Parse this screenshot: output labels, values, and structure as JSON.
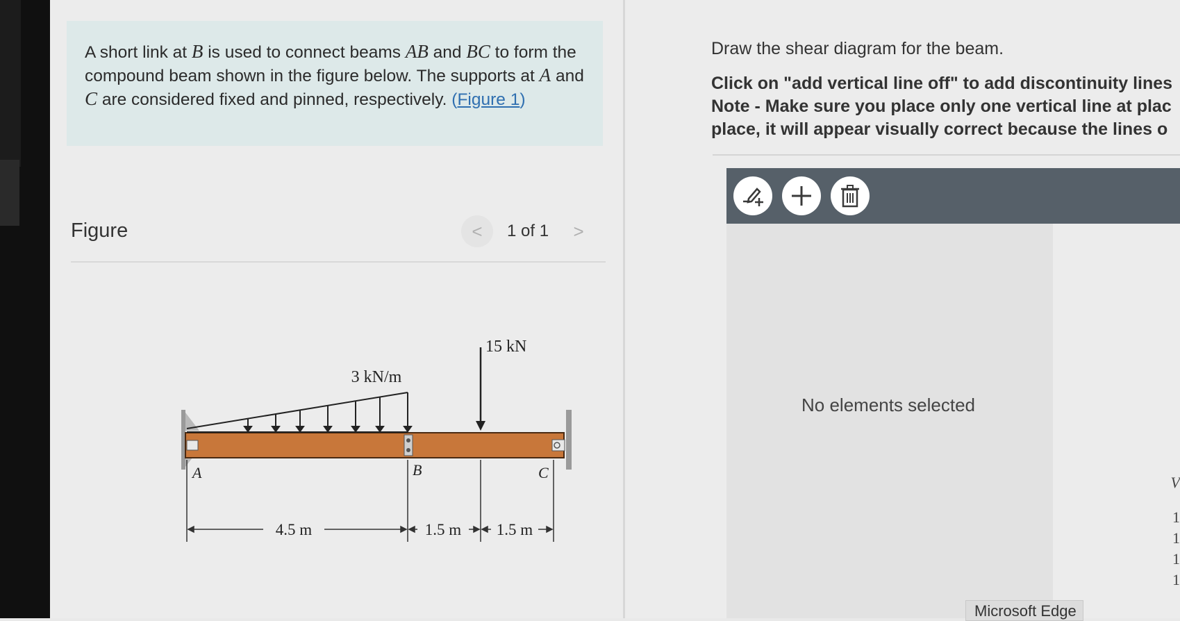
{
  "problem": {
    "p1": "A short link at ",
    "m1": "B",
    "p2": " is used to connect beams ",
    "m2": "AB",
    "p3": " and ",
    "m3": "BC",
    "p4": " to form the compound beam shown in the figure below. The supports at ",
    "m4": "A",
    "p5": " and ",
    "m5": "C",
    "p6": " are considered fixed and pinned, respectively. ",
    "link_open": "(",
    "link_text": "Figure 1",
    "link_close": ")"
  },
  "figure": {
    "title": "Figure",
    "pager_prev": "<",
    "pager_text": "1 of 1",
    "pager_next": ">"
  },
  "beam": {
    "load_point": "15 kN",
    "load_dist": "3 kN/m",
    "label_a": "A",
    "label_b": "B",
    "label_c": "C",
    "dim_ab": "4.5 m",
    "dim_b_load": "1.5 m",
    "dim_load_c": "1.5 m"
  },
  "task": {
    "instruction": "Draw the shear diagram for the beam.",
    "line1": "Click on \"add vertical line off\" to add discontinuity lines",
    "line2": "Note - Make sure you place only one vertical line at plac",
    "line3": "place, it will appear visually correct because the lines o"
  },
  "toolbar": {
    "tool1_icon": "pencil-add-icon",
    "tool2_icon": "plus-icon",
    "tool3_icon": "trash-icon"
  },
  "canvas": {
    "empty_message": "No elements selected",
    "axis_fragment_label": "V",
    "axis_fragment_ticks": [
      "1",
      "1",
      "1",
      "1"
    ]
  },
  "edge_tooltip": "Microsoft Edge",
  "colors": {
    "prompt_bg": "#dde9e9",
    "link": "#2f6fb0",
    "beam_fill": "#c8773a",
    "toolbar_bg": "#566069"
  }
}
